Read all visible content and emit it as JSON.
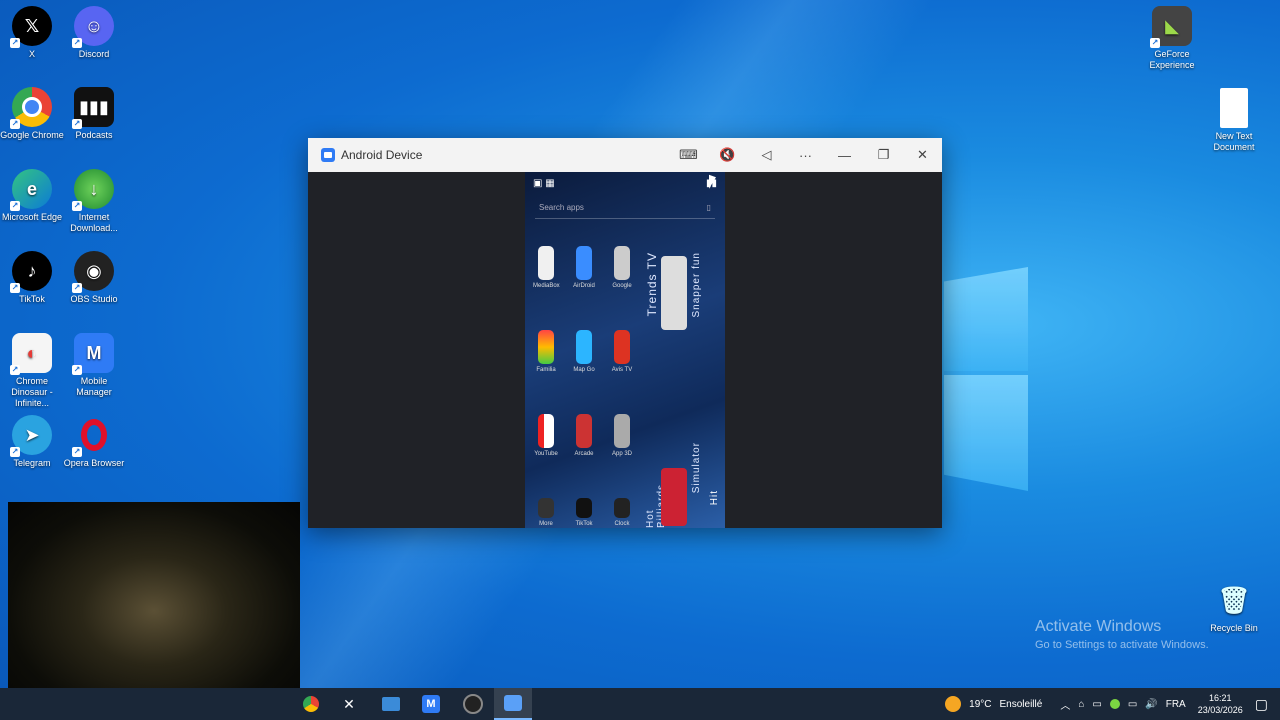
{
  "desktop": {
    "left_icons": [
      {
        "label": "X",
        "icon": "x-icon"
      },
      {
        "label": "Discord",
        "icon": "discord-icon"
      },
      {
        "label": "Google Chrome",
        "icon": "chrome-icon"
      },
      {
        "label": "Podcasts",
        "icon": "podcasts-icon"
      },
      {
        "label": "Microsoft Edge",
        "icon": "edge-icon"
      },
      {
        "label": "Internet Download...",
        "icon": "idm-icon"
      },
      {
        "label": "TikTok",
        "icon": "tiktok-icon"
      },
      {
        "label": "OBS Studio",
        "icon": "obs-icon"
      },
      {
        "label": "Chrome Dinosaur - Infinite...",
        "icon": "chrome-doc-icon"
      },
      {
        "label": "Mobile Manager",
        "icon": "mobile-manager-icon"
      },
      {
        "label": "Telegram",
        "icon": "telegram-icon"
      },
      {
        "label": "Opera Browser",
        "icon": "opera-icon"
      }
    ],
    "right_icons": [
      {
        "label": "GeForce Experience",
        "icon": "geforce-icon"
      },
      {
        "label": "New Text Document",
        "icon": "text-document-icon"
      },
      {
        "label": "Recycle Bin",
        "icon": "recycle-bin-icon"
      }
    ],
    "watermark": {
      "title": "Activate Windows",
      "subtitle": "Go to Settings to activate Windows."
    }
  },
  "window": {
    "title": "Android Device",
    "controls": {
      "keyboard": "⌨",
      "volume": "🔇",
      "back": "◁",
      "more": "···",
      "minimize": "—",
      "restore": "❐",
      "close": "✕"
    }
  },
  "phone": {
    "search_placeholder": "Search apps",
    "apps": [
      "MediaBox",
      "AirDroid",
      "Google",
      "Familia",
      "Map Go",
      "Avis TV",
      "YouTube",
      "Arcade",
      "App 3D",
      "More",
      "TikTok",
      "Clock"
    ],
    "side_texts": [
      "Trends TV",
      "Snapper fun",
      "Hot Billiards",
      "Simulator",
      "Hit"
    ]
  },
  "taskbar": {
    "weather": {
      "temp": "19°C",
      "condition": "Ensoleillé"
    },
    "language": "FRA",
    "time": "16:21",
    "date": "23/03/2026"
  }
}
